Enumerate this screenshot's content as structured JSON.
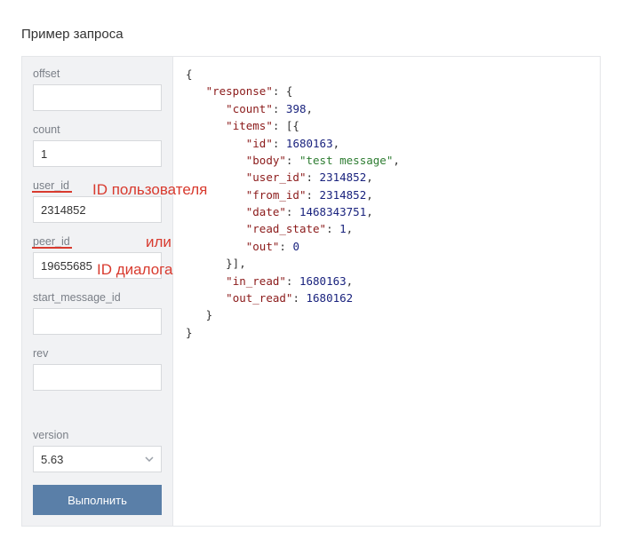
{
  "title": "Пример запроса",
  "sidebar": {
    "offset": {
      "label": "offset",
      "value": ""
    },
    "count": {
      "label": "count",
      "value": "1"
    },
    "user_id": {
      "label": "user_id",
      "value": "2314852"
    },
    "peer_id": {
      "label": "peer_id",
      "value": "19655685"
    },
    "start_message_id": {
      "label": "start_message_id",
      "value": ""
    },
    "rev": {
      "label": "rev",
      "value": ""
    },
    "version": {
      "label": "version",
      "value": "5.63"
    }
  },
  "run_label": "Выполнить",
  "annotations": {
    "user_id_note": "ID пользователя",
    "or": "или",
    "peer_id_note": "ID диалога"
  },
  "response": {
    "root_key": "response",
    "count_key": "count",
    "count_val": 398,
    "items_key": "items",
    "item": {
      "id_key": "id",
      "id_val": 1680163,
      "body_key": "body",
      "body_val": "test message",
      "user_id_key": "user_id",
      "user_id_val": 2314852,
      "from_id_key": "from_id",
      "from_id_val": 2314852,
      "date_key": "date",
      "date_val": 1468343751,
      "read_state_key": "read_state",
      "read_state_val": 1,
      "out_key": "out",
      "out_val": 0
    },
    "in_read_key": "in_read",
    "in_read_val": 1680163,
    "out_read_key": "out_read",
    "out_read_val": 1680162
  }
}
